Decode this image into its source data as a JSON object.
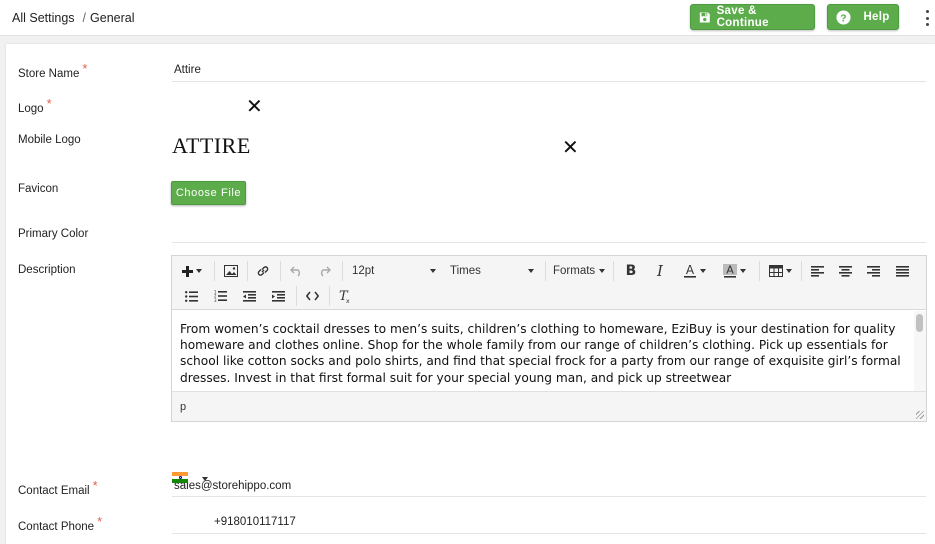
{
  "breadcrumb": {
    "root": "All Settings",
    "separator": "/",
    "current": "General"
  },
  "header": {
    "save_label": "Save & Continue",
    "help_label": "Help"
  },
  "fields": {
    "store_name": {
      "label": "Store Name",
      "value": "Attire",
      "required": "*"
    },
    "logo": {
      "label": "Logo",
      "required": "*",
      "remove": "✕"
    },
    "mobile_logo": {
      "label": "Mobile Logo",
      "logo_text": "ATTIRE",
      "remove": "✕"
    },
    "favicon": {
      "label": "Favicon",
      "button": "Choose File"
    },
    "primary_color": {
      "label": "Primary Color"
    },
    "description": {
      "label": "Description",
      "font_size": "12pt",
      "font_family": "Times",
      "formats": "Formats",
      "body": "From women’s cocktail dresses to men’s suits, children’s clothing to homeware, EziBuy is your destination for quality homeware and clothes online. Shop for the whole family from our range of children’s clothing. Pick up essentials for school like cotton socks and polo shirts, and find that special frock for a party from our range of exquisite girl’s formal dresses. Invest in that first formal suit for your special young man, and pick up streetwear",
      "status_path": "p"
    },
    "contact_email": {
      "label": "Contact Email",
      "value": "sales@storehippo.com",
      "required": "*"
    },
    "contact_phone": {
      "label": "Contact Phone",
      "value": "+918010117117",
      "required": "*"
    }
  },
  "colors": {
    "accent": "#5cac4c",
    "required": "#e0624a"
  }
}
